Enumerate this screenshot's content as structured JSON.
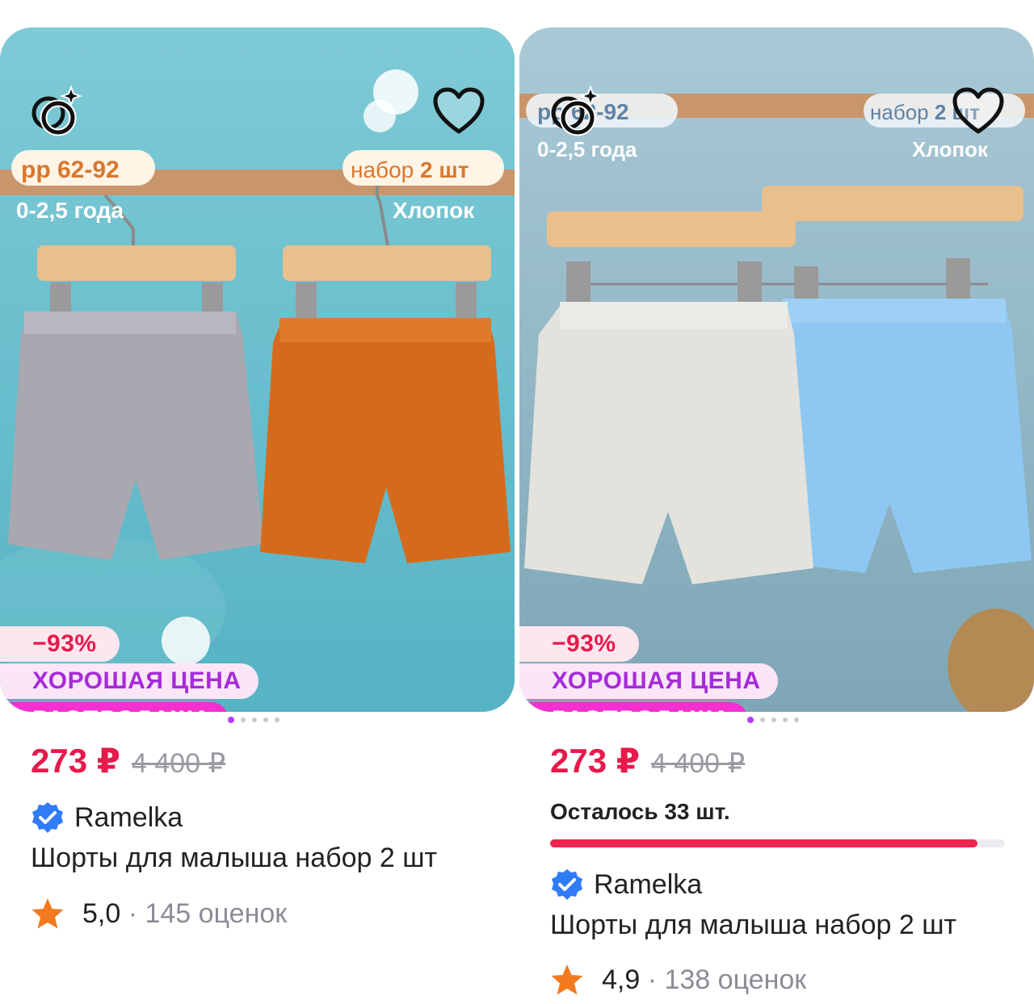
{
  "products": [
    {
      "discount": "−93%",
      "good_price": "ХОРОШАЯ ЦЕНА",
      "sale": "РАСПРОДАЖА",
      "price": "273 ₽",
      "old_price": "4 400 ₽",
      "brand": "Ramelka",
      "title": "Шорты для малыша набор 2 шт",
      "rating": "5,0",
      "reviews": "· 145 оценок",
      "image_labels": {
        "size": "рр 62-92",
        "set": "набор",
        "set_qty": "2 шт",
        "age": "0-2,5 года",
        "material": "Хлопок"
      },
      "shorts_colors": [
        "#a9a8b0",
        "#d66a1c"
      ],
      "carousel": {
        "count": 5,
        "active": 1
      }
    },
    {
      "discount": "−93%",
      "good_price": "ХОРОШАЯ ЦЕНА",
      "sale": "РАСПРОДАЖА",
      "price": "273 ₽",
      "old_price": "4 400 ₽",
      "stock_text": "Осталось 33 шт.",
      "stock_level": 0.94,
      "brand": "Ramelka",
      "title": "Шорты для малыша набор 2 шт",
      "rating": "4,9",
      "reviews": "· 138 оценок",
      "image_labels": {
        "size": "рр 62-92",
        "set": "набор",
        "set_qty": "2 шт",
        "age": "0-2,5 года",
        "material": "Хлопок"
      },
      "shorts_colors": [
        "#e3e2dd",
        "#8ec8f2"
      ],
      "carousel": {
        "count": 5,
        "active": 1
      }
    }
  ],
  "colors": {
    "price": "#e8194b",
    "good_price": "#a62bd9",
    "sale_bg": "#f52fd0",
    "verified": "#2f7cf6",
    "star": "#f47a1f",
    "stock_bar": "#f0234c"
  },
  "icons": {
    "ar": "rings-sparkle-icon",
    "favorite": "heart-outline-icon",
    "verified": "verified-check-icon",
    "rating": "star-icon"
  }
}
